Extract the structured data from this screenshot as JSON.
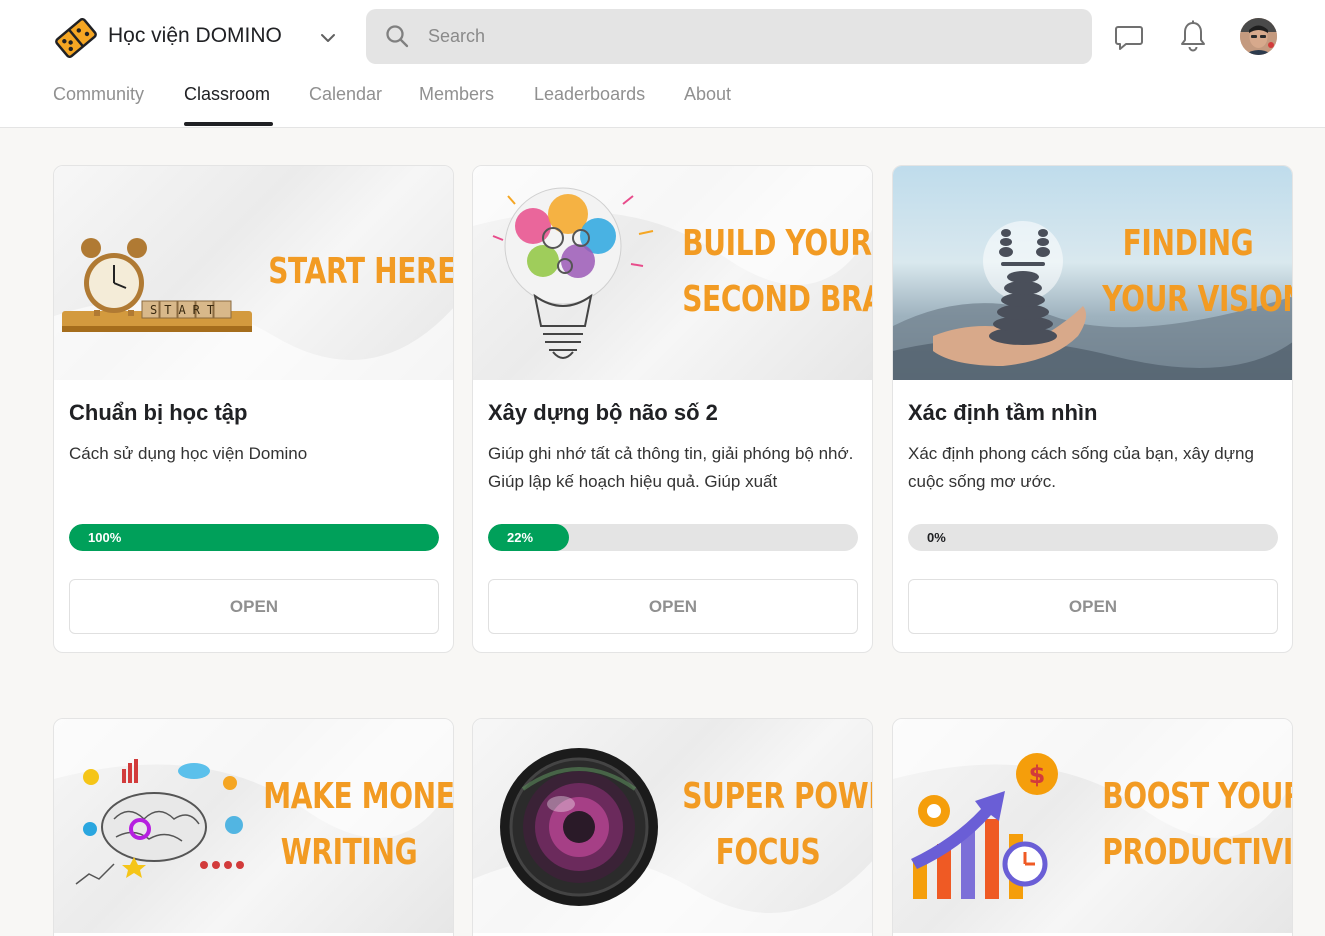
{
  "header": {
    "brand": "Học viện DOMINO",
    "search_placeholder": "Search"
  },
  "tabs": [
    {
      "label": "Community",
      "active": false
    },
    {
      "label": "Classroom",
      "active": true
    },
    {
      "label": "Calendar",
      "active": false
    },
    {
      "label": "Members",
      "active": false
    },
    {
      "label": "Leaderboards",
      "active": false
    },
    {
      "label": "About",
      "active": false
    }
  ],
  "courses": [
    {
      "cover_lines": [
        "START HERE"
      ],
      "cover_image": "alarm-clock-start-blocks",
      "title": "Chuẩn bị học tập",
      "description": "Cách sử dụng học viện Domino",
      "progress": 100,
      "progress_label": "100%",
      "button": "OPEN"
    },
    {
      "cover_lines": [
        "BUILD YOUR",
        "SECOND BRAIN"
      ],
      "cover_image": "lightbulb-brain-gears",
      "title": "Xây dựng bộ não số 2",
      "description": "Giúp ghi nhớ tất cả thông tin, giải phóng bộ nhớ. Giúp lập kế hoạch hiệu quả. Giúp xuất",
      "progress": 22,
      "progress_label": "22%",
      "button": "OPEN"
    },
    {
      "cover_lines": [
        "FINDING",
        "YOUR VISION"
      ],
      "cover_image": "hand-holding-stacked-stones",
      "title": "Xác định tầm nhìn",
      "description": "Xác định phong cách sống của bạn, xây dựng cuộc sống mơ ước.",
      "progress": 0,
      "progress_label": "0%",
      "button": "OPEN"
    },
    {
      "cover_lines": [
        "MAKE MONEY",
        "WRITING"
      ],
      "cover_image": "brain-doodle-sketch"
    },
    {
      "cover_lines": [
        "SUPER POWER",
        "FOCUS"
      ],
      "cover_image": "camera-lens"
    },
    {
      "cover_lines": [
        "BOOST YOUR",
        "PRODUCTIVITY"
      ],
      "cover_image": "growth-arrow-coin-clock"
    }
  ],
  "colors": {
    "accent_orange": "#f29b23",
    "progress_green": "#00a05a",
    "track_gray": "#e4e4e4"
  }
}
